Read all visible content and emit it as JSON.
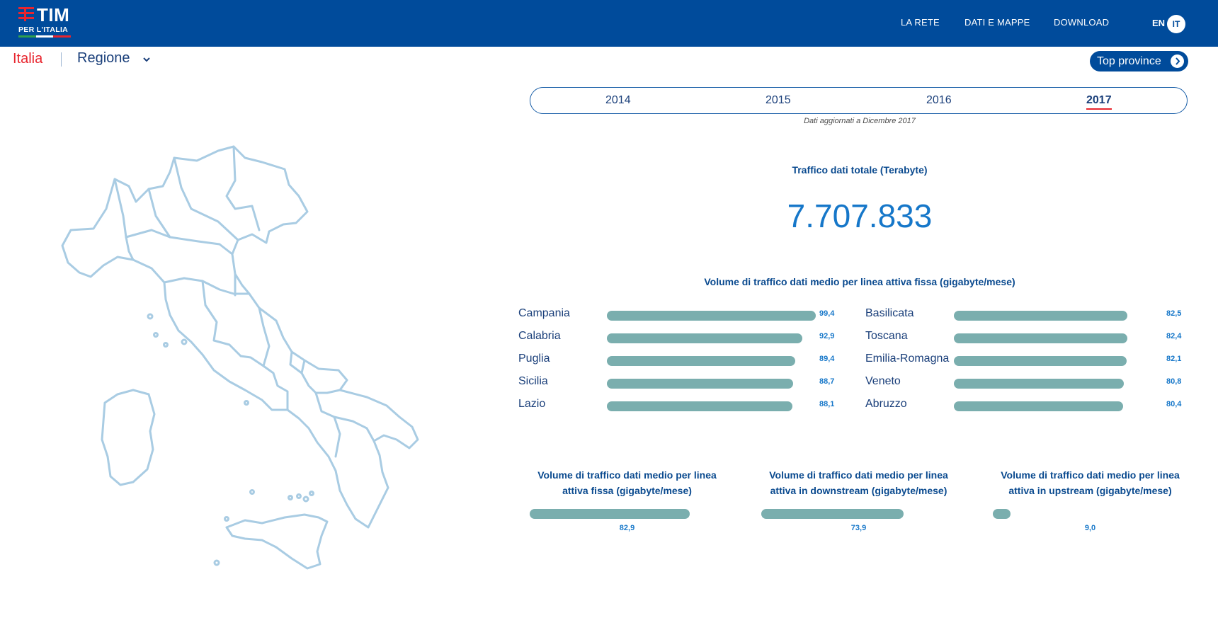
{
  "header": {
    "logo_word": "TIM",
    "logo_sub": "PER L'ITALIA",
    "nav": [
      "LA RETE",
      "DATI E MAPPE",
      "DOWNLOAD"
    ],
    "lang_en": "EN",
    "lang_it": "IT",
    "brand_color": "#004b9b",
    "accent_color": "#e8252e"
  },
  "filters": {
    "country": "Italia",
    "region_select": "Regione",
    "top_provinces_button": "Top province"
  },
  "years": {
    "options": [
      "2014",
      "2015",
      "2016",
      "2017"
    ],
    "selected": "2017",
    "updated_note": "Dati aggiornati a Dicembre 2017"
  },
  "total": {
    "title": "Traffico dati totale (Terabyte)",
    "value": "7.707.833"
  },
  "ranking": {
    "title": "Volume di traffico dati medio per linea attiva fissa (gigabyte/mese)",
    "bar_color": "#7aaeae",
    "left": [
      {
        "name": "Campania",
        "value": "99,4",
        "num": 99.4
      },
      {
        "name": "Calabria",
        "value": "92,9",
        "num": 92.9
      },
      {
        "name": "Puglia",
        "value": "89,4",
        "num": 89.4
      },
      {
        "name": "Sicilia",
        "value": "88,7",
        "num": 88.7
      },
      {
        "name": "Lazio",
        "value": "88,1",
        "num": 88.1
      }
    ],
    "right": [
      {
        "name": "Basilicata",
        "value": "82,5",
        "num": 82.5
      },
      {
        "name": "Toscana",
        "value": "82,4",
        "num": 82.4
      },
      {
        "name": "Emilia-Romagna",
        "value": "82,1",
        "num": 82.1
      },
      {
        "name": "Veneto",
        "value": "80,8",
        "num": 80.8
      },
      {
        "name": "Abruzzo",
        "value": "80,4",
        "num": 80.4
      }
    ]
  },
  "summary": [
    {
      "title_line1": "Volume di traffico dati medio per linea",
      "title_line2": "attiva fissa (gigabyte/mese)",
      "value": "82,9",
      "num": 82.9
    },
    {
      "title_line1": "Volume di traffico dati medio per linea",
      "title_line2": "attiva in downstream (gigabyte/mese)",
      "value": "73,9",
      "num": 73.9
    },
    {
      "title_line1": "Volume di traffico dati medio per linea",
      "title_line2": "attiva in upstream (gigabyte/mese)",
      "value": "9,0",
      "num": 9.0
    }
  ],
  "map": {
    "icon": "italy-regions-map",
    "stroke_color": "#a9cce3"
  }
}
